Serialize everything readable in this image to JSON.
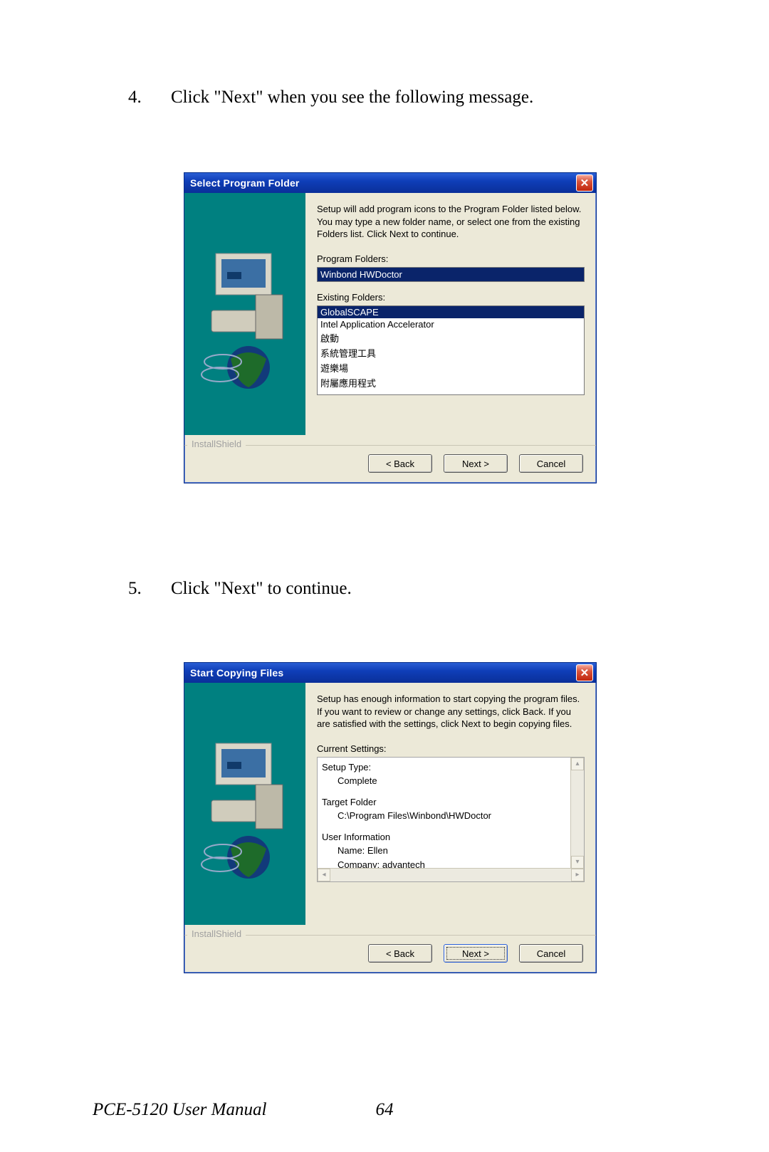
{
  "page": {
    "footer_manual": "PCE-5120 User Manual",
    "footer_page": "64"
  },
  "steps": {
    "s4": {
      "num": "4.",
      "text": "Click \"Next\" when you see the following message."
    },
    "s5": {
      "num": "5.",
      "text": "Click \"Next\" to continue."
    }
  },
  "dialog1": {
    "title": "Select Program Folder",
    "close": "✕",
    "description": "Setup will add program icons to the Program Folder listed below. You may type a new folder name, or select one from the existing Folders list.  Click Next to continue.",
    "program_folders_label": "Program Folders:",
    "program_folders_value": "Winbond HWDoctor",
    "existing_folders_label": "Existing Folders:",
    "existing_folders": [
      "GlobalSCAPE",
      "Intel Application Accelerator",
      "啟動",
      "系統管理工具",
      "遊樂場",
      "附屬應用程式"
    ],
    "legend": "InstallShield",
    "buttons": {
      "back": "< Back",
      "next": "Next >",
      "cancel": "Cancel"
    }
  },
  "dialog2": {
    "title": "Start Copying Files",
    "close": "✕",
    "description": "Setup has enough information to start copying the program files. If you want to review or change any settings, click Back.  If you are satisfied with the settings, click Next to begin copying files.",
    "current_settings_label": "Current Settings:",
    "settings": {
      "setup_type_h": "Setup Type:",
      "setup_type_v": "Complete",
      "target_h": "Target Folder",
      "target_v": "C:\\Program Files\\Winbond\\HWDoctor",
      "user_h": "User Information",
      "user_name": "Name: Ellen",
      "user_company": "Company: advantech"
    },
    "legend": "InstallShield",
    "buttons": {
      "back": "< Back",
      "next": "Next >",
      "cancel": "Cancel"
    }
  }
}
